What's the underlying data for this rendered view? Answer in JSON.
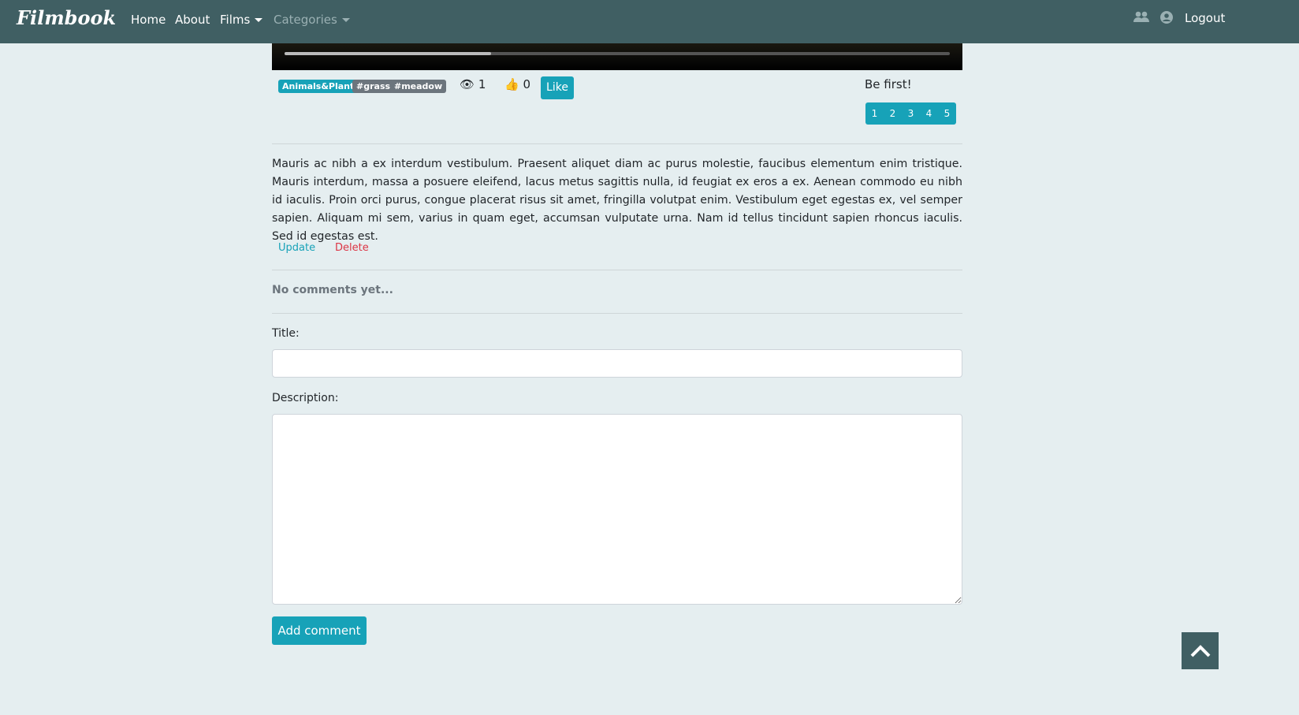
{
  "nav": {
    "brand": "Filmbook",
    "home": "Home",
    "about": "About",
    "films": "Films",
    "categories": "Categories",
    "logout": "Logout",
    "icons": [
      "users-icon",
      "user-circle-icon"
    ]
  },
  "video": {
    "progress_percent": 31
  },
  "tags": [
    {
      "label": "Animals&Plants",
      "color": "#17a2b8"
    },
    {
      "label": "#grass",
      "color": "#6c757d"
    },
    {
      "label": "#meadow",
      "color": "#6c757d"
    }
  ],
  "stats": {
    "views": "1",
    "likes": "0",
    "like_button": "Like"
  },
  "rating": {
    "prompt": "Be first!",
    "options": [
      "1",
      "2",
      "3",
      "4",
      "5"
    ]
  },
  "description": "Mauris ac nibh a ex interdum vestibulum. Praesent aliquet diam ac purus molestie, faucibus elementum enim tristique. Mauris interdum, massa a posuere eleifend, lacus metus sagittis nulla, id feugiat ex eros a ex. Aenean commodo eu nibh id iaculis. Proin orci purus, congue placerat risus sit amet, fringilla volutpat enim. Vestibulum eget egestas ex, vel semper sapien. Aliquam mi sem, varius in quam eget, accumsan vulputate urna. Nam id tellus tincidunt sapien rhoncus iaculis. Sed id egestas est.",
  "actions": {
    "update": "Update",
    "delete": "Delete"
  },
  "comments": {
    "empty": "No comments yet...",
    "title_label": "Title:",
    "title_value": "",
    "description_label": "Description:",
    "description_value": "",
    "submit": "Add comment"
  }
}
